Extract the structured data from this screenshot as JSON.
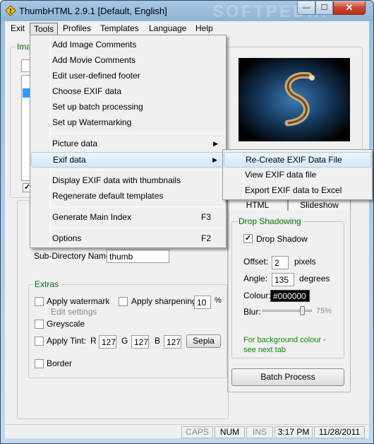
{
  "window": {
    "title": "ThumbHTML 2.9.1  [Default, English]",
    "watermark": "SOFTPEDIA",
    "min_glyph": "—",
    "max_glyph": "☐",
    "close_glyph": "✕"
  },
  "menubar": {
    "items": [
      "Exit",
      "Tools",
      "Profiles",
      "Templates",
      "Language",
      "Help"
    ]
  },
  "tools_menu": {
    "items": [
      {
        "label": "Add Image Comments"
      },
      {
        "label": "Add Movie Comments"
      },
      {
        "label": "Edit user-defined footer"
      },
      {
        "label": "Choose EXIF data"
      },
      {
        "label": "Set up batch processing"
      },
      {
        "label": "Set up Watermarking"
      },
      {
        "label": "Picture data",
        "submenu": true
      },
      {
        "label": "Exif data",
        "submenu": true,
        "highlighted": true
      },
      {
        "label": "Display EXIF data with thumbnails"
      },
      {
        "label": "Regenerate default templates"
      },
      {
        "label": "Generate Main Index",
        "shortcut": "F3"
      },
      {
        "label": "Options",
        "shortcut": "F2"
      }
    ]
  },
  "exif_submenu": {
    "items": [
      {
        "label": "Re-Create EXIF Data File",
        "highlighted": true
      },
      {
        "label": "View EXIF data file"
      },
      {
        "label": "Export EXIF data to Excel"
      }
    ]
  },
  "left_panel": {
    "group_label_partial": "Ima",
    "subdir_label": "Sub-Directory Name:",
    "subdir_value": "thumb"
  },
  "extras": {
    "label": "Extras",
    "apply_watermark": "Apply watermark",
    "edit_settings": "Edit settings",
    "apply_sharpening": "Apply sharpening",
    "sharpening_value": "10",
    "sharpening_unit": "%",
    "greyscale": "Greyscale",
    "apply_tint": "Apply Tint:",
    "r_label": "R",
    "r_value": "127",
    "g_label": "G",
    "g_value": "127",
    "b_label": "B",
    "b_value": "127",
    "sepia_button": "Sepia",
    "border": "Border"
  },
  "tabs": [
    "HTML",
    "Slideshow"
  ],
  "drop_shadowing": {
    "label": "Drop Shadowing",
    "drop_shadow": "Drop Shadow",
    "drop_shadow_checked": true,
    "offset_label": "Offset:",
    "offset_value": "2",
    "offset_unit": "pixels",
    "angle_label": "Angle:",
    "angle_value": "135",
    "angle_unit": "degrees",
    "colour_label": "Colour:",
    "colour_value": "#000000",
    "blur_label": "Blur:",
    "blur_value": "75%",
    "blur_level": 0.75,
    "note": "For background colour - see next tab"
  },
  "batch_button": "Batch Process",
  "statusbar": {
    "caps": "CAPS",
    "num": "NUM",
    "ins": "INS",
    "time": "3:17 PM",
    "date": "11/28/2011"
  },
  "colors": {
    "green_label": "#0a6a0a",
    "highlight": "#d6e8f9"
  }
}
